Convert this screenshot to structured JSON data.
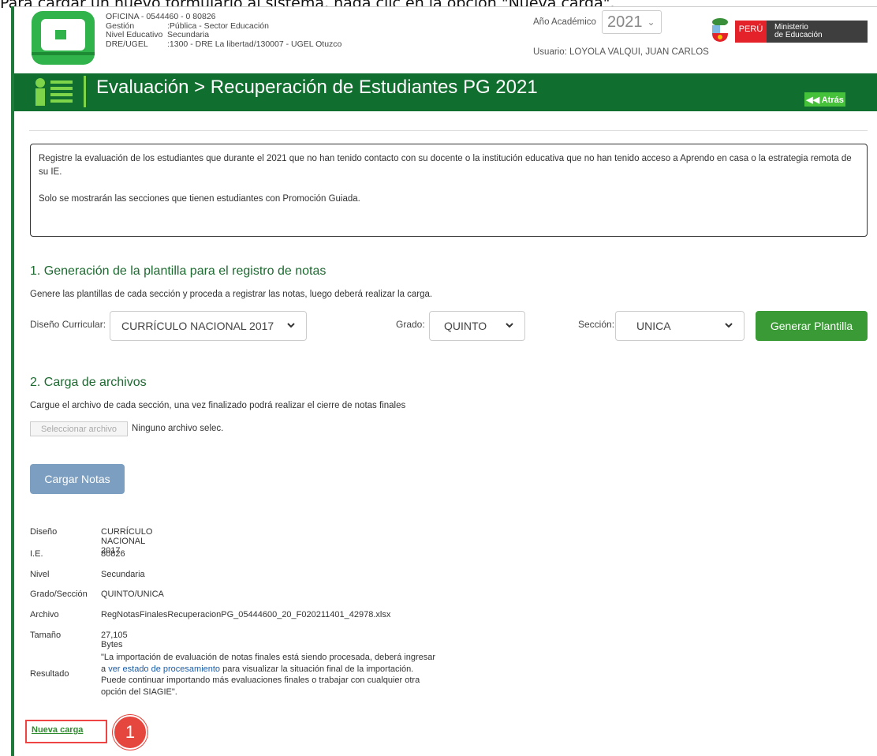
{
  "caption": "Para cargar un nuevo formulario al sistema, haga clic en la opción \"Nueva carga\".",
  "header": {
    "oficina": "OFICINA - 0544460 - 0  80826",
    "rows": [
      {
        "k": "Gestión",
        "v": ":Pública - Sector Educación"
      },
      {
        "k": "Nivel Educativo",
        "v": "Secundaria"
      },
      {
        "k": "DRE/UGEL",
        "v": ":1300 - DRE La libertad/130007 - UGEL Otuzco"
      }
    ],
    "year_label": "Año Académico",
    "year_value": "2021",
    "user": "Usuario: LOYOLA VALQUI, JUAN CARLOS",
    "peru": "PERÚ",
    "ministerio_line1": "Ministerio",
    "ministerio_line2": "de Educación"
  },
  "titlebar": {
    "title": "Evaluación > Recuperación de Estudiantes PG 2021",
    "back": "◀◀ Atrás"
  },
  "info": {
    "p1": "Registre la evaluación de los estudiantes que durante el 2021 que no han tenido contacto con su docente o la institución educativa que no han tenido acceso a Aprendo en casa o la estrategia remota de su IE.",
    "p2": "Solo se mostrarán las secciones que tienen estudiantes con Promoción Guiada."
  },
  "section1": {
    "title": "1. Generación de la plantilla para el registro de notas",
    "subtitle": "Genere las plantillas de cada sección y proceda a registrar las notas, luego deberá realizar la carga.",
    "diseno_label": "Diseño Curricular:",
    "diseno_value": "CURRÍCULO NACIONAL 2017",
    "grado_label": "Grado:",
    "grado_value": "QUINTO",
    "seccion_label": "Sección:",
    "seccion_value": "UNICA",
    "button": "Generar Plantilla"
  },
  "section2": {
    "title": "2. Carga de archivos",
    "subtitle": "Cargue el archivo de cada sección, una vez finalizado podrá realizar el cierre de notas finales",
    "file_button": "Seleccionar archivo",
    "file_none": "Ninguno archivo selec.",
    "cargar": "Cargar Notas"
  },
  "details": [
    {
      "k": "Diseño",
      "v": "CURRÍCULO NACIONAL 2017"
    },
    {
      "k": "I.E.",
      "v": "80826"
    },
    {
      "k": "Nivel",
      "v": "Secundaria"
    },
    {
      "k": "Grado/Sección",
      "v": "QUINTO/UNICA"
    },
    {
      "k": "Archivo",
      "v": "RegNotasFinalesRecuperacionPG_05444600_20_F020211401_42978.xlsx"
    },
    {
      "k": "Tamaño",
      "v": "27,105 Bytes"
    }
  ],
  "resultado": {
    "label": "Resultado",
    "before": "\"La importación de evaluación de notas finales está siendo procesada, deberá ingresar a ",
    "link": "ver estado de procesamiento",
    "after": " para visualizar la situación final de la importación. Puede continuar importando más evaluaciones finales o trabajar con cualquier otra opción del SIAGIE\"."
  },
  "nueva_carga": "Nueva carga",
  "badge": "1",
  "colors": {
    "primary_green": "#106e2f",
    "button_green": "#3a9a35",
    "callout_red": "#e5463e"
  }
}
